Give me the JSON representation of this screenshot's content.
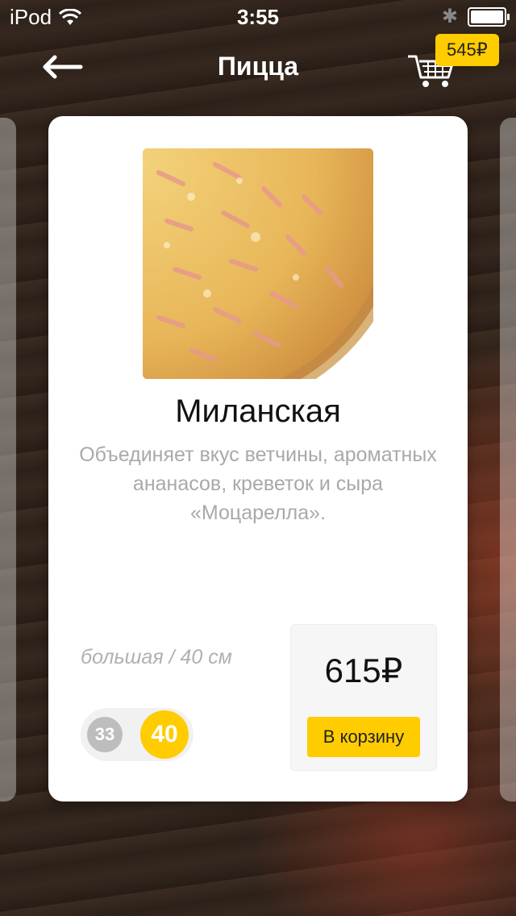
{
  "status_bar": {
    "carrier": "iPod",
    "time": "3:55"
  },
  "header": {
    "title": "Пицца",
    "cart_total": "545₽"
  },
  "product": {
    "name": "Миланская",
    "description": "Объединяет вкус ветчины, ароматных ананасов, креветок и сыра «Моцарелла».",
    "size_label": "большая / 40 см",
    "sizes": [
      "33",
      "40"
    ],
    "selected_size": "40",
    "price": "615₽",
    "add_to_cart_label": "В корзину"
  },
  "colors": {
    "accent": "#ffcc00",
    "card_bg": "#ffffff",
    "muted_text": "#a9a9a9"
  },
  "icons": [
    "wifi-icon",
    "bluetooth-icon",
    "battery-icon",
    "back-arrow-icon",
    "cart-icon"
  ]
}
